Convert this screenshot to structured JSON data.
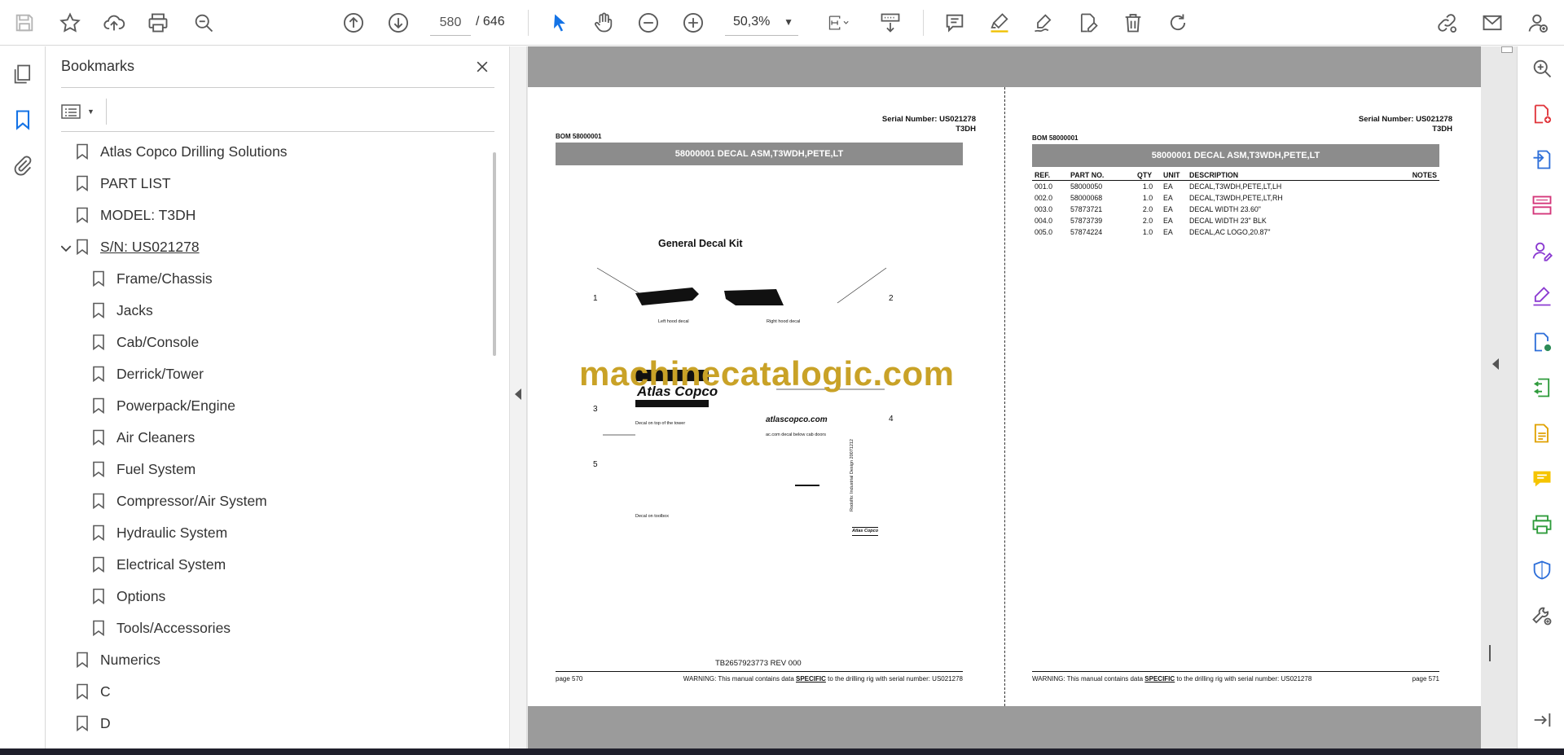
{
  "toolbar": {
    "page_current": "580",
    "page_total": "/ 646",
    "zoom": "50,3%",
    "icons": [
      "save-icon",
      "star-icon",
      "upload-icon",
      "print-icon",
      "find-icon",
      "page-up-icon",
      "page-down-icon",
      "select-arrow-icon",
      "hand-icon",
      "zoom-out-icon",
      "zoom-in-icon",
      "fit-page-icon",
      "scroll-mode-icon",
      "comment-icon",
      "highlight-icon",
      "sign-icon",
      "edit-pdf-icon",
      "delete-icon",
      "redo-icon",
      "share-link-icon",
      "email-icon",
      "account-icon"
    ],
    "colors": {
      "accent": "#1473e6",
      "icon": "#5a5a5a"
    }
  },
  "left_rail": {
    "icons": [
      "pages-icon",
      "bookmark-icon",
      "attachment-icon"
    ]
  },
  "bookmarks": {
    "title": "Bookmarks",
    "items": [
      {
        "label": "Atlas Copco Drilling Solutions",
        "level": 0
      },
      {
        "label": "PART LIST",
        "level": 0
      },
      {
        "label": "MODEL: T3DH",
        "level": 0
      },
      {
        "label": "S/N: US021278",
        "level": 0,
        "expanded": true,
        "current": true
      },
      {
        "label": "Frame/Chassis",
        "level": 1
      },
      {
        "label": "Jacks",
        "level": 1
      },
      {
        "label": "Cab/Console",
        "level": 1
      },
      {
        "label": "Derrick/Tower",
        "level": 1
      },
      {
        "label": "Powerpack/Engine",
        "level": 1
      },
      {
        "label": "Air Cleaners",
        "level": 1
      },
      {
        "label": "Fuel System",
        "level": 1
      },
      {
        "label": "Compressor/Air System",
        "level": 1
      },
      {
        "label": "Hydraulic System",
        "level": 1
      },
      {
        "label": "Electrical System",
        "level": 1
      },
      {
        "label": "Options",
        "level": 1
      },
      {
        "label": "Tools/Accessories",
        "level": 1
      },
      {
        "label": "Numerics",
        "level": 0
      },
      {
        "label": "C",
        "level": 0
      },
      {
        "label": "D",
        "level": 0
      }
    ]
  },
  "doc": {
    "left_page": {
      "serial": "Serial Number: US021278",
      "model": "T3DH",
      "bom": "BOM 58000001",
      "banner": "58000001 DECAL ASM,T3WDH,PETE,LT",
      "kit_title": "General Decal Kit",
      "callouts": [
        "1",
        "2",
        "3",
        "4",
        "5"
      ],
      "label_left_hood": "Left hood decal",
      "label_right_hood": "Right hood decal",
      "label_tower": "Decal on top of the tower",
      "label_cab": "ac.com decal below cab doors",
      "label_toolbox": "Decal on toolbox",
      "logo_text": "Atlas Copco",
      "url_text": "atlascopco.com",
      "vertical_note": "Rodolfo: Industrial Design 20071212",
      "doc_number": "TB2657923773 REV 000",
      "footer_page": "page 570",
      "footer_warning_pre": "WARNING:  This manual contains data ",
      "footer_warning_em": "SPECIFIC",
      "footer_warning_post": " to the drilling rig with serial number: US021278"
    },
    "right_page": {
      "serial": "Serial Number: US021278",
      "model": "T3DH",
      "bom": "BOM 58000001",
      "banner": "58000001 DECAL ASM,T3WDH,PETE,LT",
      "columns": [
        "REF.",
        "PART NO.",
        "QTY",
        "UNIT",
        "DESCRIPTION",
        "NOTES"
      ],
      "rows": [
        [
          "001.0",
          "58000050",
          "1.0",
          "EA",
          "DECAL,T3WDH,PETE,LT,LH",
          ""
        ],
        [
          "002.0",
          "58000068",
          "1.0",
          "EA",
          "DECAL,T3WDH,PETE,LT,RH",
          ""
        ],
        [
          "003.0",
          "57873721",
          "2.0",
          "EA",
          "DECAL WIDTH 23.60\"",
          ""
        ],
        [
          "004.0",
          "57873739",
          "2.0",
          "EA",
          "DECAL WIDTH 23\" BLK",
          ""
        ],
        [
          "005.0",
          "57874224",
          "1.0",
          "EA",
          "DECAL,AC LOGO,20.87\"",
          ""
        ]
      ],
      "footer_page": "page 571",
      "footer_warning_pre": "WARNING:  This manual contains data ",
      "footer_warning_em": "SPECIFIC",
      "footer_warning_post": " to the drilling rig with serial number: US021278"
    },
    "watermark": "machinecatalogic.com"
  },
  "right_rail": {
    "icons": [
      "zoom-tool-icon",
      "create-pdf-icon",
      "export-pdf-icon",
      "organize-pages-icon",
      "request-signature-icon",
      "fill-sign-icon",
      "send-review-icon",
      "compress-icon",
      "scan-icon",
      "comment-tool-icon",
      "print-production-icon",
      "protect-icon",
      "more-tools-icon",
      "collapse-panel-icon"
    ]
  }
}
